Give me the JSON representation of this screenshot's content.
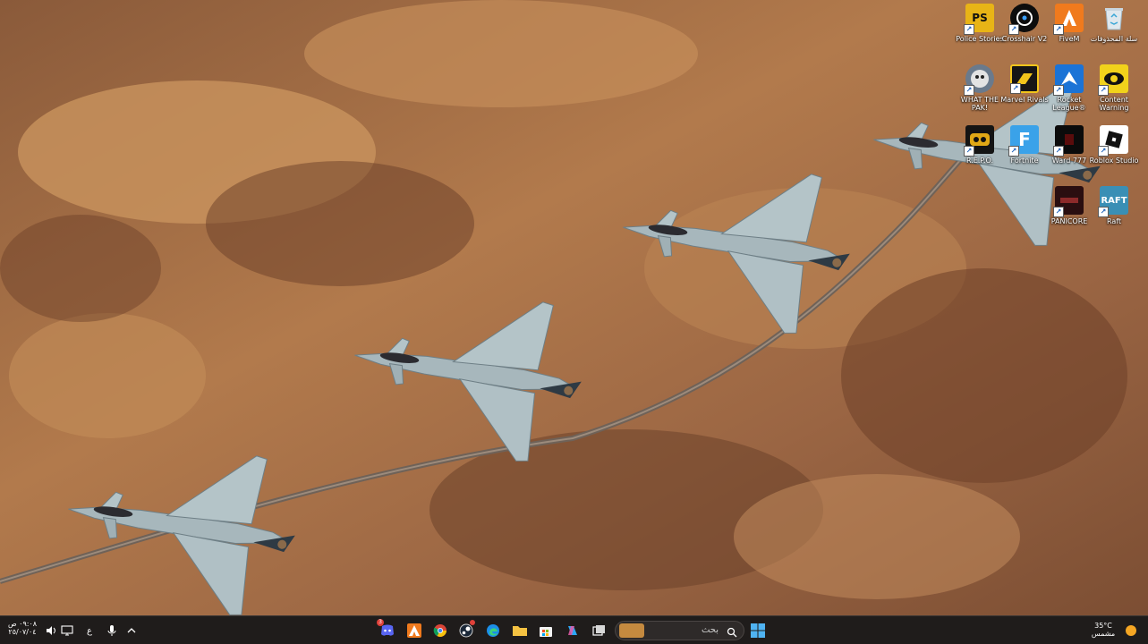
{
  "desktop": {
    "icons": [
      {
        "label": "Police Stories",
        "glyph": "PS",
        "icon": "police-stories-icon"
      },
      {
        "label": "Crosshair V2",
        "glyph": "",
        "icon": "crosshair-icon"
      },
      {
        "label": "FiveM",
        "glyph": "",
        "icon": "fivem-icon"
      },
      {
        "label": "سلة المحذوفات",
        "glyph": "",
        "icon": "recycle-bin-icon"
      },
      {
        "label": "WHAT THE PAK!",
        "glyph": "",
        "icon": "what-the-pak-icon"
      },
      {
        "label": "Marvel Rivals",
        "glyph": "",
        "icon": "marvel-rivals-icon"
      },
      {
        "label": "Rocket League®",
        "glyph": "",
        "icon": "rocket-league-icon"
      },
      {
        "label": "Content Warning",
        "glyph": "",
        "icon": "content-warning-icon"
      },
      {
        "label": "R.E.P.O.",
        "glyph": "",
        "icon": "repo-icon"
      },
      {
        "label": "Fortnite",
        "glyph": "F",
        "icon": "fortnite-icon"
      },
      {
        "label": "Ward 777",
        "glyph": "",
        "icon": "ward-777-icon"
      },
      {
        "label": "Roblox Studio",
        "glyph": "",
        "icon": "roblox-studio-icon"
      },
      {
        "label": "PANICORE",
        "glyph": "",
        "icon": "panicore-icon"
      },
      {
        "label": "Raft",
        "glyph": "RAFT",
        "icon": "raft-icon"
      }
    ]
  },
  "taskbar": {
    "weather": {
      "temp": "35°C",
      "condition": "مشمس",
      "icon": "sun-icon"
    },
    "search": {
      "placeholder": "بحث",
      "icon": "search-icon"
    },
    "start_icon": "windows-start-icon",
    "apps": [
      {
        "name": "discord",
        "icon": "discord-icon",
        "badge": "3"
      },
      {
        "name": "fivem",
        "icon": "fivem-icon"
      },
      {
        "name": "chrome",
        "icon": "chrome-icon"
      },
      {
        "name": "steam",
        "icon": "steam-icon"
      },
      {
        "name": "edge",
        "icon": "edge-icon"
      },
      {
        "name": "file-explorer",
        "icon": "folder-icon"
      },
      {
        "name": "microsoft-store",
        "icon": "store-icon"
      },
      {
        "name": "copilot",
        "icon": "copilot-icon"
      },
      {
        "name": "task-view",
        "icon": "task-view-icon"
      }
    ],
    "tray": {
      "chevron_icon": "chevron-up-icon",
      "mic_icon": "microphone-icon",
      "language": "ع",
      "network_icon": "network-icon",
      "volume_icon": "volume-icon",
      "time": "٠٩:٠٨ ص",
      "date": "٢٥/٠٧/٠٤"
    }
  },
  "colors": {
    "taskbar_bg": "#1f1c1b",
    "desert_light": "#c98f5a",
    "desert_dark": "#6e4028",
    "jet": "#a9b9bf",
    "accent_blue": "#1b8fe8"
  }
}
